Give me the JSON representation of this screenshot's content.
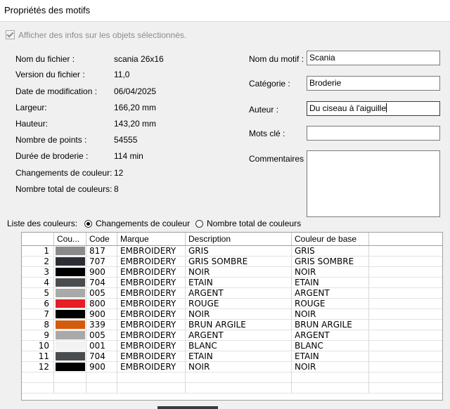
{
  "window": {
    "title": "Propriétés des motifs"
  },
  "show_info_checkbox": {
    "label": "Afficher des infos sur les objets sélectionnés.",
    "checked": true,
    "disabled": true
  },
  "file_info": [
    {
      "label": "Nom du fichier :",
      "value": "scania 26x16"
    },
    {
      "label": "Version du fichier :",
      "value": "11,0"
    },
    {
      "label": "Date de modification :",
      "value": "06/04/2025"
    },
    {
      "label": "Largeur:",
      "value": "166,20 mm"
    },
    {
      "label": "Hauteur:",
      "value": "143,20 mm"
    },
    {
      "label": "Nombre de points :",
      "value": "54555"
    },
    {
      "label": "Durée de broderie :",
      "value": "114 min"
    },
    {
      "label": "Changements de couleur:",
      "value": "12"
    },
    {
      "label": "Nombre total de couleurs:",
      "value": "8"
    }
  ],
  "fields": {
    "motif_name": {
      "label": "Nom du motif :",
      "value": "Scania"
    },
    "category": {
      "label": "Catégorie :",
      "value": "Broderie"
    },
    "author": {
      "label": "Auteur :",
      "value": "Du ciseau à l'aiguille"
    },
    "keywords": {
      "label": "Mots clé :",
      "value": ""
    },
    "comments": {
      "label": "Commentaires :",
      "value": ""
    }
  },
  "color_list": {
    "label": "Liste des couleurs:",
    "options": [
      {
        "label": "Changements de couleur",
        "selected": true
      },
      {
        "label": "Nombre total de couleurs",
        "selected": false
      }
    ],
    "columns": [
      "Cou...",
      "Code",
      "Marque",
      "Description",
      "Couleur de base"
    ],
    "rows": [
      {
        "n": "1",
        "color": "#8a8a8a",
        "code": "817",
        "brand": "EMBROIDERY",
        "desc": "GRIS",
        "base": "GRIS"
      },
      {
        "n": "2",
        "color": "#2b2f33",
        "code": "707",
        "brand": "EMBROIDERY",
        "desc": "GRIS SOMBRE",
        "base": "GRIS SOMBRE"
      },
      {
        "n": "3",
        "color": "#000000",
        "code": "900",
        "brand": "EMBROIDERY",
        "desc": "NOIR",
        "base": "NOIR"
      },
      {
        "n": "4",
        "color": "#4a4d50",
        "code": "704",
        "brand": "EMBROIDERY",
        "desc": "ETAIN",
        "base": "ETAIN"
      },
      {
        "n": "5",
        "color": "#a9a9a9",
        "code": "005",
        "brand": "EMBROIDERY",
        "desc": "ARGENT",
        "base": "ARGENT"
      },
      {
        "n": "6",
        "color": "#e61e25",
        "code": "800",
        "brand": "EMBROIDERY",
        "desc": "ROUGE",
        "base": "ROUGE"
      },
      {
        "n": "7",
        "color": "#000000",
        "code": "900",
        "brand": "EMBROIDERY",
        "desc": "NOIR",
        "base": "NOIR"
      },
      {
        "n": "8",
        "color": "#d45a0c",
        "code": "339",
        "brand": "EMBROIDERY",
        "desc": "BRUN ARGILE",
        "base": "BRUN ARGILE"
      },
      {
        "n": "9",
        "color": "#a9a9a9",
        "code": "005",
        "brand": "EMBROIDERY",
        "desc": "ARGENT",
        "base": "ARGENT"
      },
      {
        "n": "10",
        "color": "#f2f2f2",
        "code": "001",
        "brand": "EMBROIDERY",
        "desc": "BLANC",
        "base": "BLANC"
      },
      {
        "n": "11",
        "color": "#4a4d50",
        "code": "704",
        "brand": "EMBROIDERY",
        "desc": "ETAIN",
        "base": "ETAIN"
      },
      {
        "n": "12",
        "color": "#000000",
        "code": "900",
        "brand": "EMBROIDERY",
        "desc": "NOIR",
        "base": "NOIR"
      }
    ]
  }
}
